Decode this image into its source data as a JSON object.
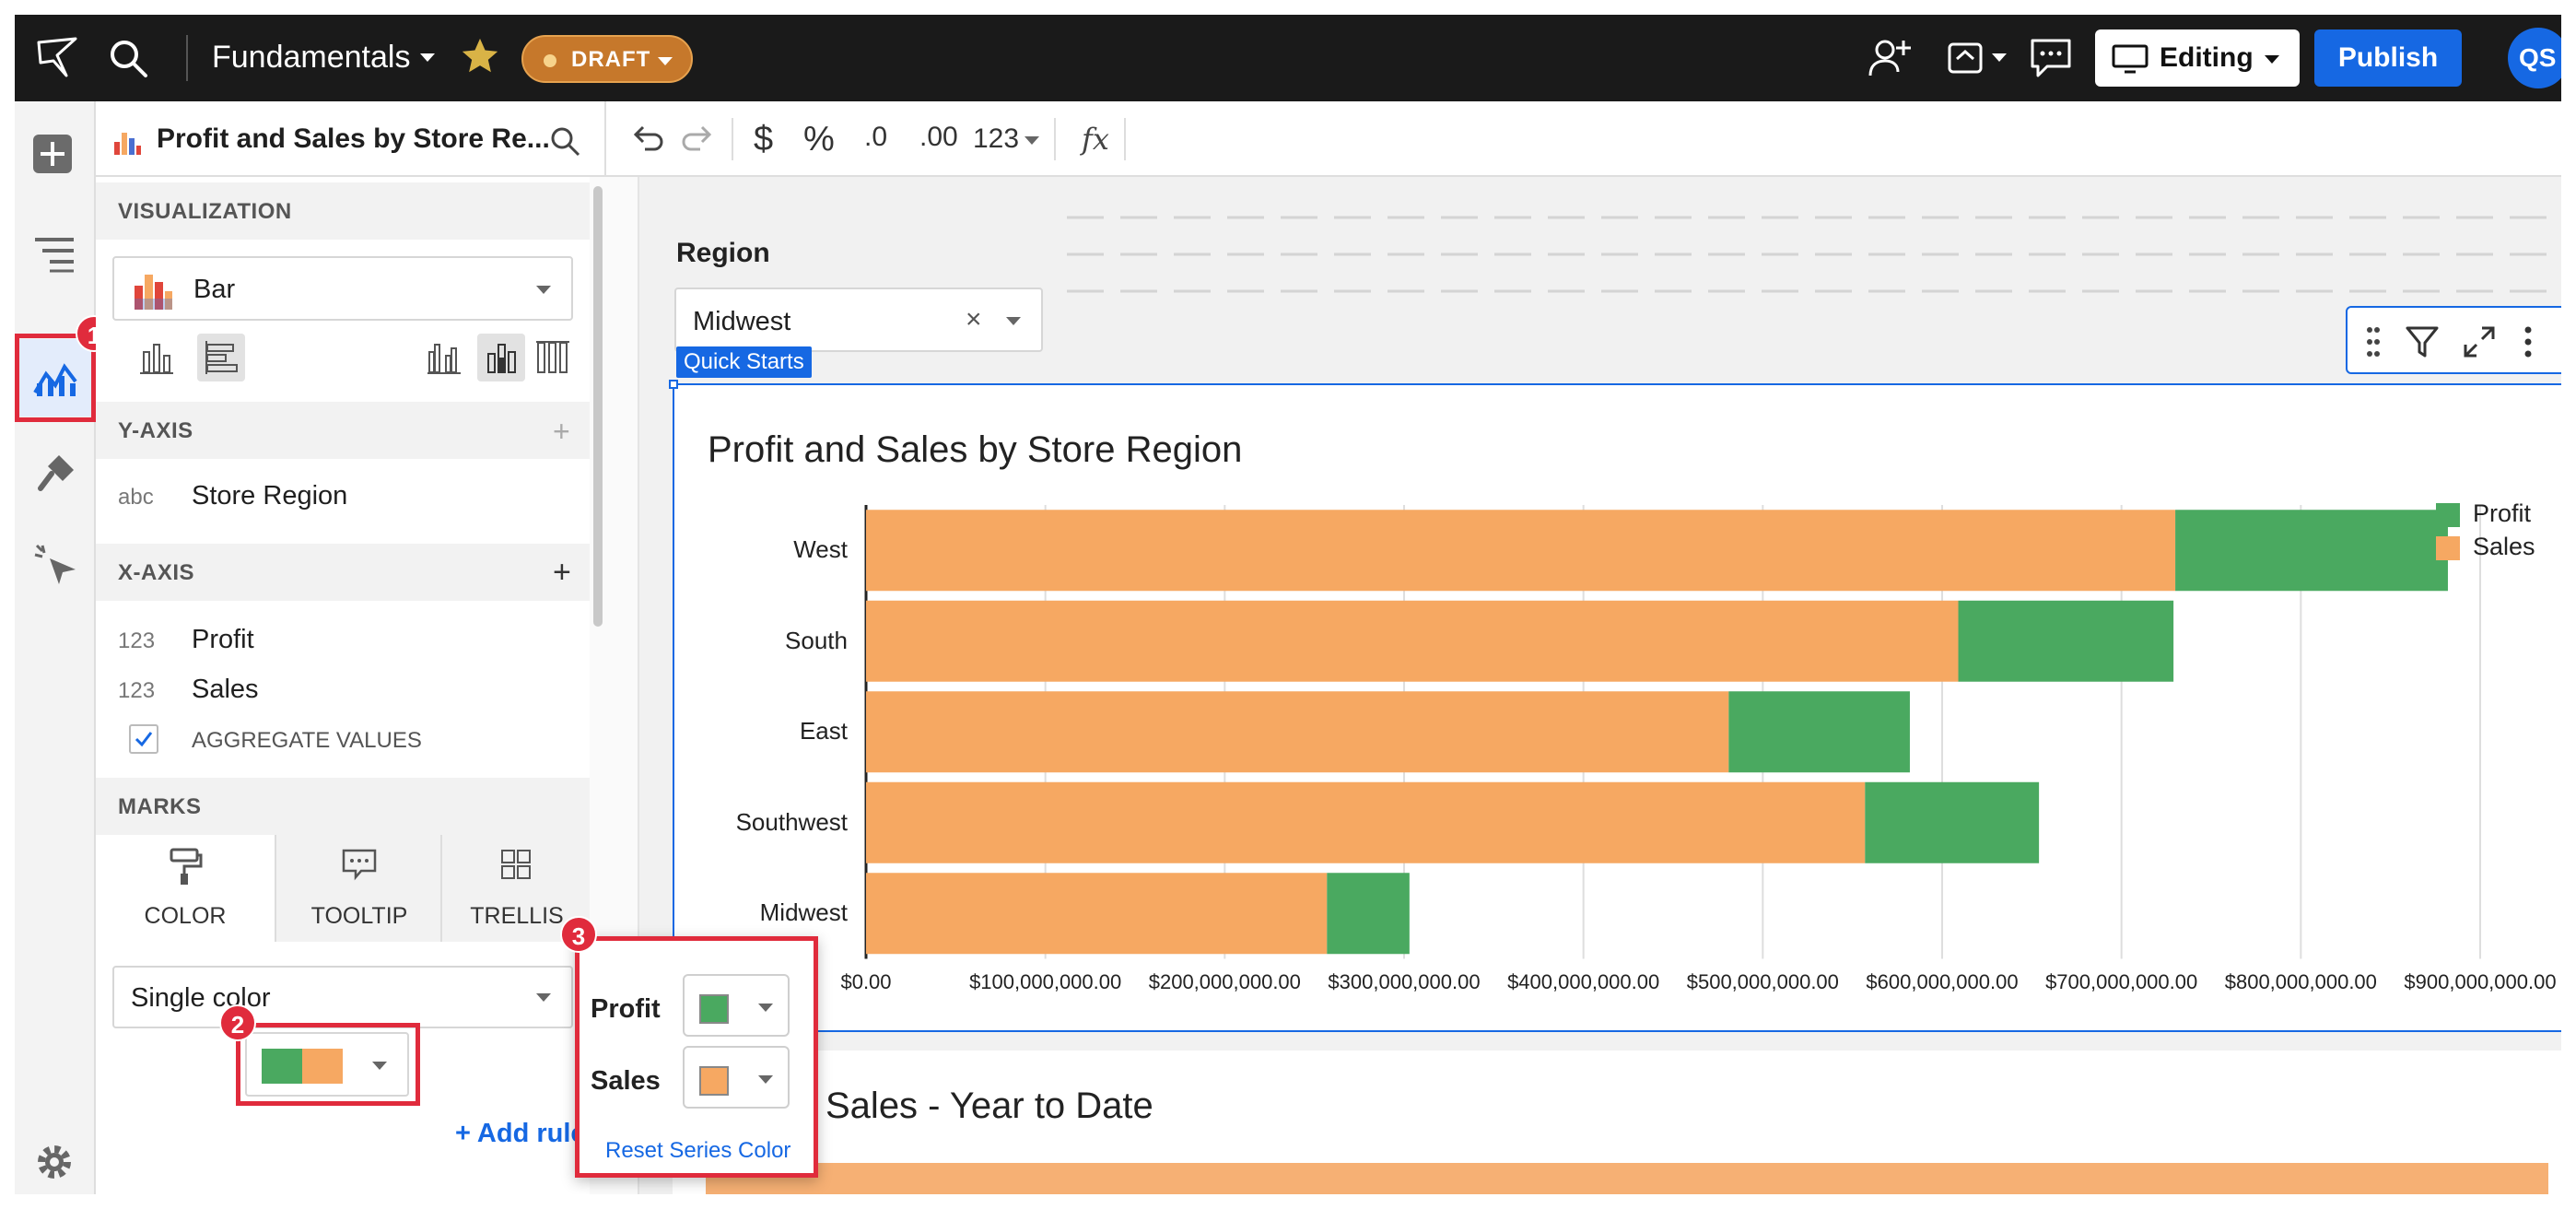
{
  "topbar": {
    "workbook_title": "Fundamentals",
    "draft_label": "DRAFT",
    "editing_label": "Editing",
    "publish_label": "Publish",
    "avatar_initials": "QS"
  },
  "panel": {
    "element_title": "Profit and Sales by Store Re...",
    "visualization_label": "VISUALIZATION",
    "chart_type": "Bar",
    "y_axis_label": "Y-AXIS",
    "y_axis_field_type": "abc",
    "y_axis_field": "Store Region",
    "x_axis_label": "X-AXIS",
    "x_axis_fields": [
      {
        "type": "123",
        "name": "Profit"
      },
      {
        "type": "123",
        "name": "Sales"
      }
    ],
    "aggregate_label": "AGGREGATE VALUES",
    "aggregate_checked": true,
    "marks_label": "MARKS",
    "marks_tabs": [
      "COLOR",
      "TOOLTIP",
      "TRELLIS"
    ],
    "color_mode": "Single color",
    "add_rule_label": "+ Add rule"
  },
  "toolbar": {
    "currency_symbol": "$",
    "percent_symbol": "%",
    "decrease_decimals": ".0",
    "increase_decimals": ".00",
    "number_format": "123",
    "formula_symbol": "fx"
  },
  "filter": {
    "label": "Region",
    "value": "Midwest",
    "tag": "Quick Starts"
  },
  "chart_data": {
    "type": "bar",
    "orientation": "horizontal",
    "stacked": true,
    "title": "Profit and Sales by Store Region",
    "categories": [
      "West",
      "South",
      "East",
      "Southwest",
      "Midwest"
    ],
    "series": [
      {
        "name": "Sales",
        "color": "#f6a862",
        "values": [
          730000000,
          609000000,
          481000000,
          557000000,
          257000000
        ]
      },
      {
        "name": "Profit",
        "color": "#4aa960",
        "values": [
          152000000,
          120000000,
          101000000,
          97000000,
          46000000
        ]
      }
    ],
    "legend": [
      "Profit",
      "Sales"
    ],
    "legend_position": "top-right",
    "xlim": [
      0,
      900000000
    ],
    "x_ticks": [
      "$0.00",
      "$100,000,000.00",
      "$200,000,000.00",
      "$300,000,000.00",
      "$400,000,000.00",
      "$500,000,000.00",
      "$600,000,000.00",
      "$700,000,000.00",
      "$800,000,000.00",
      "$900,000,000.00"
    ],
    "grid": true
  },
  "popover": {
    "rows": [
      {
        "label": "Profit",
        "color": "#4aa960"
      },
      {
        "label": "Sales",
        "color": "#f6a862"
      }
    ],
    "reset_label": "Reset Series Color"
  },
  "annotations": [
    "1",
    "2",
    "3"
  ],
  "second_card_title": "Sales - Year to Date",
  "colors": {
    "accent": "#1668e3",
    "annotation": "#e02b3c",
    "profit": "#4aa960",
    "sales": "#f6a862"
  }
}
